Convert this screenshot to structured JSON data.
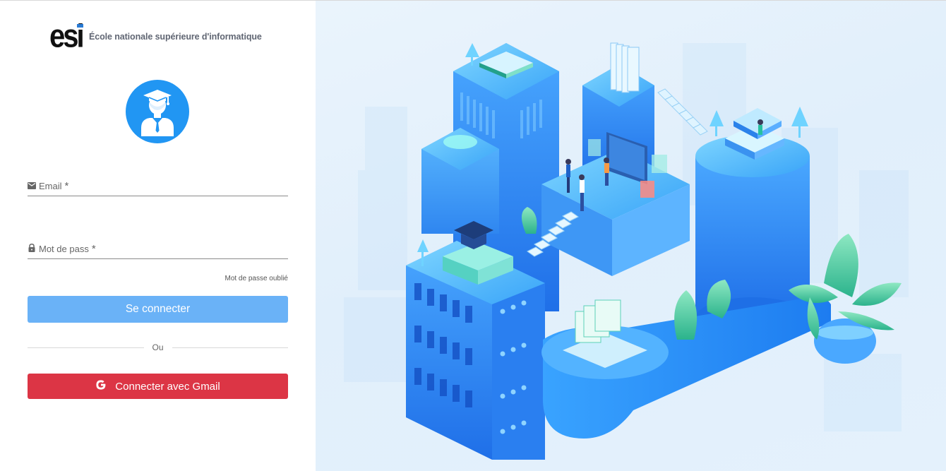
{
  "brand": {
    "name": "École nationale supérieure d'informatique",
    "logo_text": "esi",
    "icon": "esi-logo-icon"
  },
  "avatar": {
    "icon": "graduate-student-icon",
    "color": "#2196f3"
  },
  "form": {
    "email": {
      "label": "Email",
      "required_mark": "*",
      "value": "",
      "icon": "mail-icon"
    },
    "password": {
      "label": "Mot de pass",
      "required_mark": "*",
      "value": "",
      "icon": "lock-icon"
    },
    "forgot_password": "Mot de passe oublié",
    "submit_label": "Se connecter",
    "divider_text": "Ou",
    "gmail_label": "Connecter avec Gmail",
    "gmail_icon": "google-g-icon"
  },
  "colors": {
    "primary": "#6ab2f7",
    "accent": "#2196f3",
    "gmail": "#dc3545",
    "illustration_bg": "#e4f1fc"
  },
  "illustration": {
    "icon": "isometric-campus-illustration"
  }
}
